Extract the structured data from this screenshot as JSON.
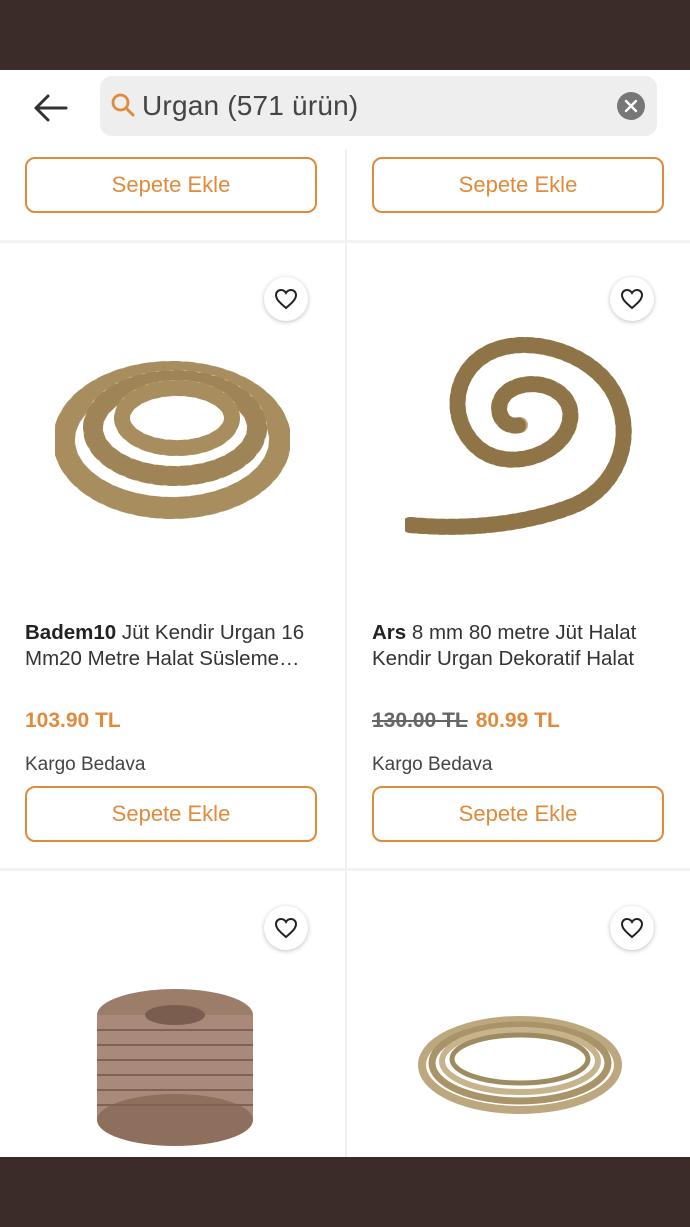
{
  "search": {
    "query": "Urgan (571 ürün)"
  },
  "cart_label": "Sepete Ekle",
  "colors": {
    "accent": "#e08a3c",
    "bar": "#3b2c2a"
  },
  "products": [
    {
      "brand": "Badem10",
      "name": " Jüt Kendir Urgan 16 Mm20 Metre Halat Süsleme…",
      "price": "103.90 TL",
      "old_price": "",
      "shipping": "Kargo Bedava"
    },
    {
      "brand": "Ars",
      "name": " 8 mm 80 metre Jüt Halat Kendir Urgan  Dekoratif Halat",
      "price": "80.99 TL",
      "old_price": "130.00 TL",
      "shipping": "Kargo Bedava"
    }
  ],
  "icons": {
    "back": "arrow-left-icon",
    "search": "magnifier-icon",
    "clear": "close-circle-icon",
    "favorite": "heart-outline-icon"
  }
}
